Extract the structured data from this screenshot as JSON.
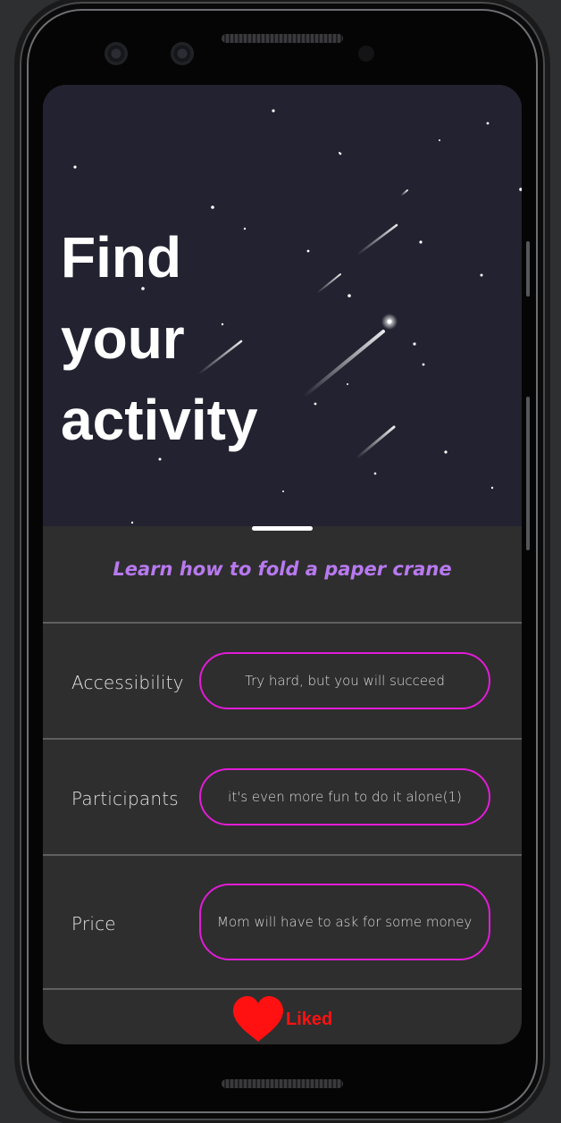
{
  "hero": {
    "title": "Find\nyour\nactivity"
  },
  "activity": {
    "name": "Learn how to fold a paper crane"
  },
  "details": [
    {
      "label": "Accessibility",
      "value": "Try hard, but you will succeed"
    },
    {
      "label": "Participants",
      "value": "it's even more fun to do it alone(1)"
    },
    {
      "label": "Price",
      "value": "Mom will have to ask for some money"
    }
  ],
  "like": {
    "label": "Liked",
    "icon": "heart-icon",
    "color": "#ff1111"
  },
  "colors": {
    "accent": "#b879f0",
    "pill_border": "#e21cd6",
    "hero_bg": "#232230",
    "panel_bg": "#2e2e2e"
  }
}
